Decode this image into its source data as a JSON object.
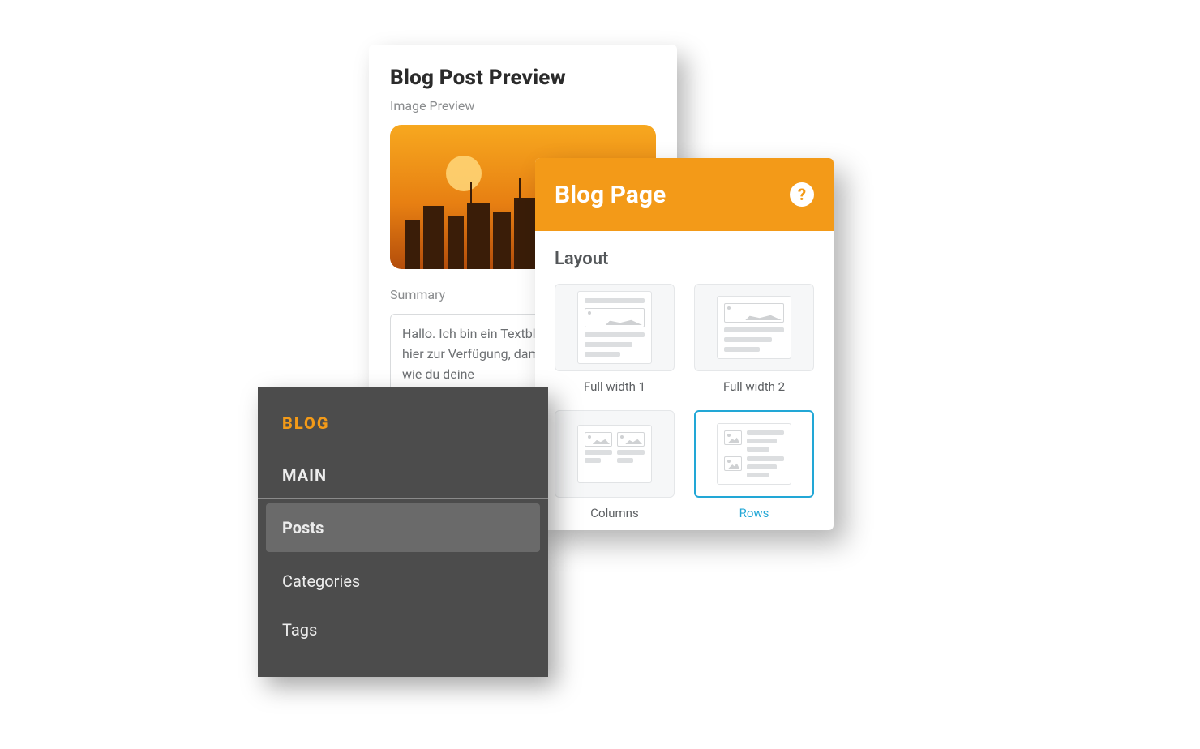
{
  "preview": {
    "title": "Blog Post Preview",
    "image_label": "Image Preview",
    "summary_label": "Summary",
    "summary_text": "Hallo. Ich bin ein Textblock. Ich stehe dir hier zur Verfügung, damit ich dir erklären, wie du deine"
  },
  "blog_page": {
    "header_title": "Blog Page",
    "help_glyph": "?",
    "layout_title": "Layout",
    "options": [
      {
        "label": "Full width 1",
        "selected": false
      },
      {
        "label": "Full width 2",
        "selected": false
      },
      {
        "label": "Columns",
        "selected": false
      },
      {
        "label": "Rows",
        "selected": true
      }
    ]
  },
  "sidebar": {
    "title": "BLOG",
    "section": "MAIN",
    "items": [
      {
        "label": "Posts",
        "active": true
      },
      {
        "label": "Categories",
        "active": false
      },
      {
        "label": "Tags",
        "active": false
      }
    ]
  },
  "colors": {
    "accent": "#f39a18",
    "selection": "#22a7d6",
    "sidebar_bg": "#4c4c4c"
  }
}
